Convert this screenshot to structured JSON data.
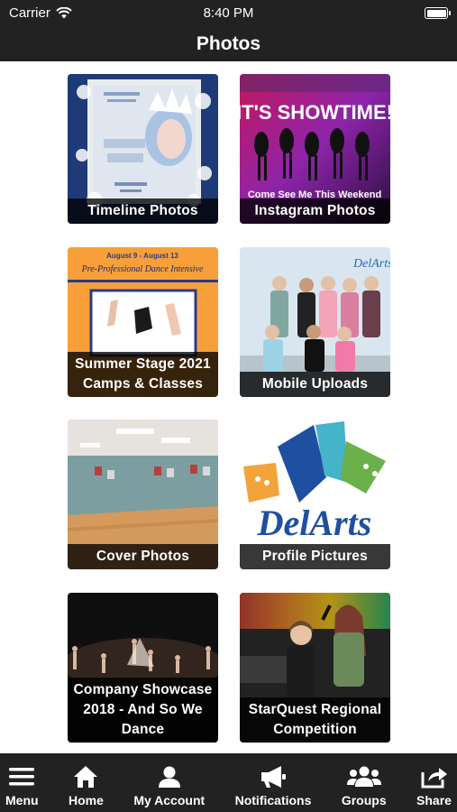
{
  "status_bar": {
    "carrier": "Carrier",
    "time": "8:40 PM"
  },
  "header": {
    "title": "Photos"
  },
  "albums": [
    {
      "label": "Timeline Photos"
    },
    {
      "label": "Instagram Photos",
      "poster_title": "IT'S SHOWTIME!",
      "poster_caption": "Come See Me This Weekend"
    },
    {
      "label": "Summer Stage 2021 Camps & Classes",
      "poster_dates": "August 9 - August 13",
      "poster_title": "Pre-Professional Dance Intensive"
    },
    {
      "label": "Mobile Uploads"
    },
    {
      "label": "Cover Photos"
    },
    {
      "label": "Profile Pictures",
      "logo_text": "DelArts"
    },
    {
      "label": "Company Showcase 2018 - And So We Dance"
    },
    {
      "label": "StarQuest Regional Competition"
    }
  ],
  "tabs": [
    {
      "label": "Menu",
      "icon": "menu-icon"
    },
    {
      "label": "Home",
      "icon": "home-icon"
    },
    {
      "label": "My Account",
      "icon": "user-icon"
    },
    {
      "label": "Notifications",
      "icon": "megaphone-icon"
    },
    {
      "label": "Groups",
      "icon": "group-icon"
    },
    {
      "label": "Share",
      "icon": "share-icon"
    }
  ],
  "colors": {
    "bar_background": "#222222",
    "label_background": "#000000",
    "text": "#ffffff"
  }
}
